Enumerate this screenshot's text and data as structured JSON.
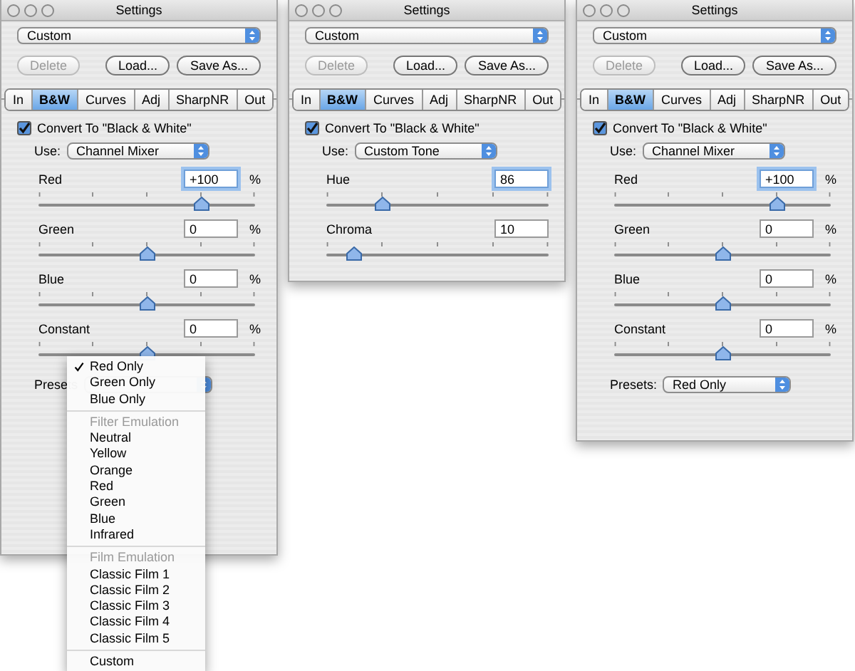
{
  "windows": [
    {
      "title": "Settings",
      "preset": "Custom",
      "buttons": [
        {
          "label": "Delete",
          "disabled": true
        },
        {
          "label": "Load...",
          "disabled": false
        },
        {
          "label": "Save As...",
          "disabled": false
        }
      ],
      "tabs": [
        {
          "label": "In",
          "selected": false
        },
        {
          "label": "B&W",
          "selected": true
        },
        {
          "label": "Curves",
          "selected": false
        },
        {
          "label": "Adj",
          "selected": false
        },
        {
          "label": "SharpNR",
          "selected": false
        },
        {
          "label": "Out",
          "selected": false
        }
      ],
      "convert": {
        "label": "Convert To \"Black & White\"",
        "checked": true
      },
      "use": {
        "label": "Use:",
        "value": "Channel Mixer"
      },
      "sliders": [
        {
          "label": "Red",
          "value": "+100",
          "unit": "%",
          "focused": true,
          "level": 0.75
        },
        {
          "label": "Green",
          "value": "0",
          "unit": "%",
          "focused": false,
          "level": 0.5
        },
        {
          "label": "Blue",
          "value": "0",
          "unit": "%",
          "focused": false,
          "level": 0.5
        },
        {
          "label": "Constant",
          "value": "0",
          "unit": "%",
          "focused": false,
          "level": 0.5
        }
      ],
      "presets": {
        "label": "Presets"
      },
      "menu": [
        {
          "kind": "item",
          "label": "Red Only",
          "checked": true
        },
        {
          "kind": "item",
          "label": "Green Only",
          "checked": false
        },
        {
          "kind": "item",
          "label": "Blue Only",
          "checked": false
        },
        {
          "kind": "separator"
        },
        {
          "kind": "header",
          "label": "Filter Emulation"
        },
        {
          "kind": "item",
          "label": "Neutral",
          "checked": false
        },
        {
          "kind": "item",
          "label": "Yellow",
          "checked": false
        },
        {
          "kind": "item",
          "label": "Orange",
          "checked": false
        },
        {
          "kind": "item",
          "label": "Red",
          "checked": false
        },
        {
          "kind": "item",
          "label": "Green",
          "checked": false
        },
        {
          "kind": "item",
          "label": "Blue",
          "checked": false
        },
        {
          "kind": "item",
          "label": "Infrared",
          "checked": false
        },
        {
          "kind": "separator"
        },
        {
          "kind": "header",
          "label": "Film Emulation"
        },
        {
          "kind": "item",
          "label": "Classic Film 1",
          "checked": false
        },
        {
          "kind": "item",
          "label": "Classic Film 2",
          "checked": false
        },
        {
          "kind": "item",
          "label": "Classic Film 3",
          "checked": false
        },
        {
          "kind": "item",
          "label": "Classic Film 4",
          "checked": false
        },
        {
          "kind": "item",
          "label": "Classic Film 5",
          "checked": false
        },
        {
          "kind": "separator"
        },
        {
          "kind": "item",
          "label": "Custom",
          "checked": false
        }
      ]
    },
    {
      "title": "Settings",
      "preset": "Custom",
      "buttons": [
        {
          "label": "Delete",
          "disabled": true
        },
        {
          "label": "Load...",
          "disabled": false
        },
        {
          "label": "Save As...",
          "disabled": false
        }
      ],
      "tabs": [
        {
          "label": "In",
          "selected": false
        },
        {
          "label": "B&W",
          "selected": true
        },
        {
          "label": "Curves",
          "selected": false
        },
        {
          "label": "Adj",
          "selected": false
        },
        {
          "label": "SharpNR",
          "selected": false
        },
        {
          "label": "Out",
          "selected": false
        }
      ],
      "convert": {
        "label": "Convert To \"Black & White\"",
        "checked": true
      },
      "use": {
        "label": "Use:",
        "value": "Custom Tone"
      },
      "sliders": [
        {
          "label": "Hue",
          "value": "86",
          "focused": true,
          "level": 0.25
        },
        {
          "label": "Chroma",
          "value": "10",
          "focused": false,
          "level": 0.12
        }
      ]
    },
    {
      "title": "Settings",
      "preset": "Custom",
      "buttons": [
        {
          "label": "Delete",
          "disabled": true
        },
        {
          "label": "Load...",
          "disabled": false
        },
        {
          "label": "Save As...",
          "disabled": false
        }
      ],
      "tabs": [
        {
          "label": "In",
          "selected": false
        },
        {
          "label": "B&W",
          "selected": true
        },
        {
          "label": "Curves",
          "selected": false
        },
        {
          "label": "Adj",
          "selected": false
        },
        {
          "label": "SharpNR",
          "selected": false
        },
        {
          "label": "Out",
          "selected": false
        }
      ],
      "convert": {
        "label": "Convert To \"Black & White\"",
        "checked": true
      },
      "use": {
        "label": "Use:",
        "value": "Channel Mixer"
      },
      "sliders": [
        {
          "label": "Red",
          "value": "+100",
          "unit": "%",
          "focused": true,
          "level": 0.75
        },
        {
          "label": "Green",
          "value": "0",
          "unit": "%",
          "focused": false,
          "level": 0.5
        },
        {
          "label": "Blue",
          "value": "0",
          "unit": "%",
          "focused": false,
          "level": 0.5
        },
        {
          "label": "Constant",
          "value": "0",
          "unit": "%",
          "focused": false,
          "level": 0.5
        }
      ],
      "presets": {
        "label": "Presets:",
        "value": "Red Only"
      }
    }
  ]
}
